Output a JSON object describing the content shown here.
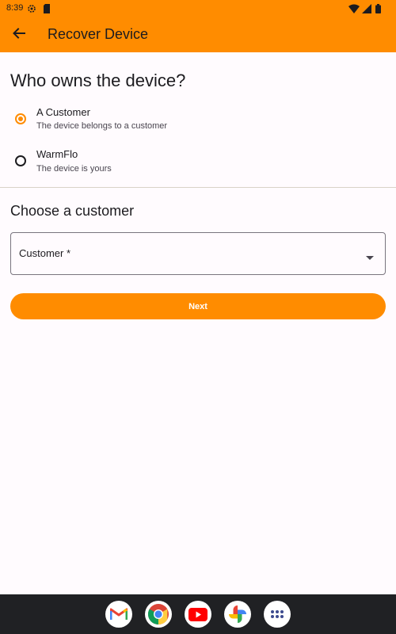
{
  "status_bar": {
    "time": "8:39",
    "icons": [
      "settings-icon",
      "sim-card-icon",
      "wifi-icon",
      "signal-icon",
      "battery-icon"
    ]
  },
  "app_bar": {
    "title": "Recover Device",
    "back_icon": "arrow-back-icon",
    "background": "#FF8C00"
  },
  "owner_section": {
    "question": "Who owns the device?",
    "options": [
      {
        "label": "A Customer",
        "description": "The device belongs to a customer",
        "selected": true
      },
      {
        "label": "WarmFlo",
        "description": "The device is yours",
        "selected": false
      }
    ]
  },
  "customer_section": {
    "title": "Choose a customer",
    "dropdown_label": "Customer *",
    "dropdown_icon": "dropdown-arrow-icon"
  },
  "next_button": {
    "label": "Next",
    "color": "#FF8C00"
  },
  "dock": {
    "apps": [
      "gmail-icon",
      "chrome-icon",
      "youtube-icon",
      "photos-icon",
      "app-drawer-icon"
    ]
  }
}
